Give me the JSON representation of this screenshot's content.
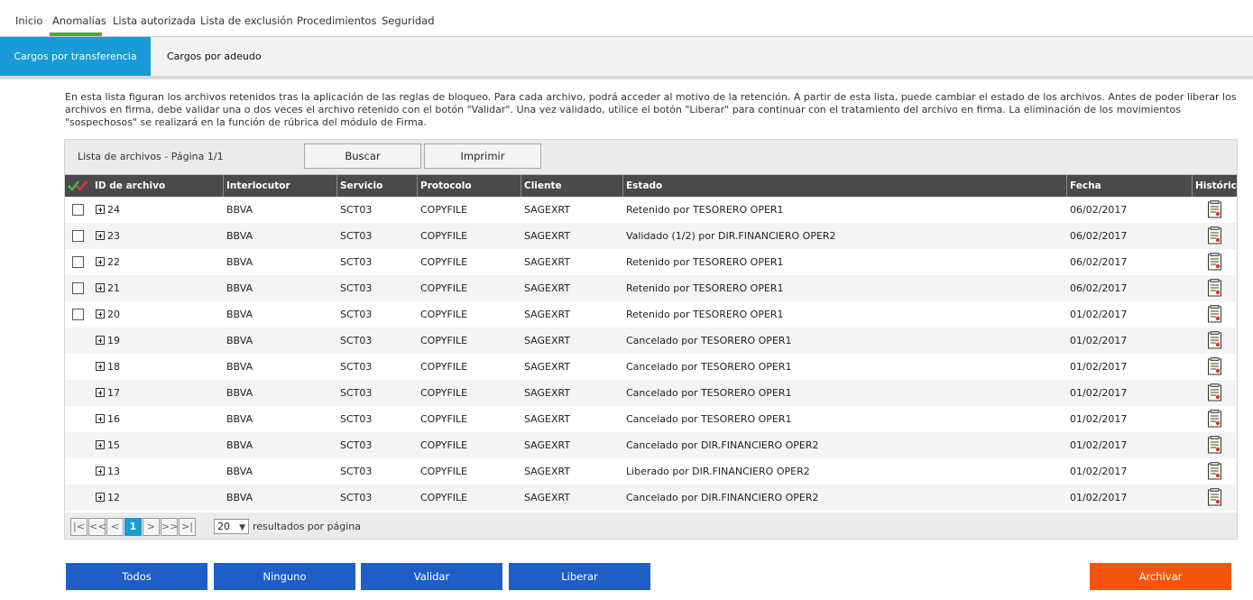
{
  "nav": {
    "items": [
      "Inicio",
      "Anomalías",
      "Lista autorizada",
      "Lista de exclusión",
      "Procedimientos",
      "Seguridad"
    ],
    "active": "Anomalías"
  },
  "subtabs": {
    "active": "Cargos por transferencia",
    "other": "Cargos por adeudo"
  },
  "description": "En esta lista figuran los archivos retenidos tras la aplicación de las reglas de bloqueo. Para cada archivo, podrá acceder al motivo de la retención. A partir de esta lista, puede cambiar el estado de los archivos. Antes de poder liberar los archivos en firma, debe validar una o dos veces el archivo retenido con el botón \"Validar\". Una vez validado, utilice el botón \"Liberar\" para continuar con el tratamiento del archivo en firma. La eliminación de los movimientos \"sospechosos\" se realizará en la función de rúbrica del módulo de Firma.",
  "panel": {
    "title": "Lista de archivos - Página 1/1",
    "search_label": "Buscar",
    "print_label": "Imprimir"
  },
  "table": {
    "headers": {
      "id": "ID de archivo",
      "interlocutor": "Interlocutor",
      "servicio": "Servicio",
      "protocolo": "Protocolo",
      "cliente": "Cliente",
      "estado": "Estado",
      "fecha": "Fecha",
      "historico": "Histórico"
    },
    "rows": [
      {
        "id": "24",
        "interlocutor": "BBVA",
        "servicio": "SCT03",
        "protocolo": "COPYFILE",
        "cliente": "SAGEXRT",
        "estado": "Retenido por TESORERO OPER1",
        "fecha": "06/02/2017",
        "checkbox": true
      },
      {
        "id": "23",
        "interlocutor": "BBVA",
        "servicio": "SCT03",
        "protocolo": "COPYFILE",
        "cliente": "SAGEXRT",
        "estado": "Validado (1/2) por DIR.FINANCIERO OPER2",
        "fecha": "06/02/2017",
        "checkbox": true
      },
      {
        "id": "22",
        "interlocutor": "BBVA",
        "servicio": "SCT03",
        "protocolo": "COPYFILE",
        "cliente": "SAGEXRT",
        "estado": "Retenido por TESORERO OPER1",
        "fecha": "06/02/2017",
        "checkbox": true
      },
      {
        "id": "21",
        "interlocutor": "BBVA",
        "servicio": "SCT03",
        "protocolo": "COPYFILE",
        "cliente": "SAGEXRT",
        "estado": "Retenido por TESORERO OPER1",
        "fecha": "06/02/2017",
        "checkbox": true
      },
      {
        "id": "20",
        "interlocutor": "BBVA",
        "servicio": "SCT03",
        "protocolo": "COPYFILE",
        "cliente": "SAGEXRT",
        "estado": "Retenido por TESORERO OPER1",
        "fecha": "01/02/2017",
        "checkbox": true
      },
      {
        "id": "19",
        "interlocutor": "BBVA",
        "servicio": "SCT03",
        "protocolo": "COPYFILE",
        "cliente": "SAGEXRT",
        "estado": "Cancelado por TESORERO OPER1",
        "fecha": "01/02/2017",
        "checkbox": false
      },
      {
        "id": "18",
        "interlocutor": "BBVA",
        "servicio": "SCT03",
        "protocolo": "COPYFILE",
        "cliente": "SAGEXRT",
        "estado": "Cancelado por TESORERO OPER1",
        "fecha": "01/02/2017",
        "checkbox": false
      },
      {
        "id": "17",
        "interlocutor": "BBVA",
        "servicio": "SCT03",
        "protocolo": "COPYFILE",
        "cliente": "SAGEXRT",
        "estado": "Cancelado por TESORERO OPER1",
        "fecha": "01/02/2017",
        "checkbox": false
      },
      {
        "id": "16",
        "interlocutor": "BBVA",
        "servicio": "SCT03",
        "protocolo": "COPYFILE",
        "cliente": "SAGEXRT",
        "estado": "Cancelado por TESORERO OPER1",
        "fecha": "01/02/2017",
        "checkbox": false
      },
      {
        "id": "15",
        "interlocutor": "BBVA",
        "servicio": "SCT03",
        "protocolo": "COPYFILE",
        "cliente": "SAGEXRT",
        "estado": "Cancelado por DIR.FINANCIERO OPER2",
        "fecha": "01/02/2017",
        "checkbox": false
      },
      {
        "id": "13",
        "interlocutor": "BBVA",
        "servicio": "SCT03",
        "protocolo": "COPYFILE",
        "cliente": "SAGEXRT",
        "estado": "Liberado por DIR.FINANCIERO OPER2",
        "fecha": "01/02/2017",
        "checkbox": false
      },
      {
        "id": "12",
        "interlocutor": "BBVA",
        "servicio": "SCT03",
        "protocolo": "COPYFILE",
        "cliente": "SAGEXRT",
        "estado": "Cancelado por DIR.FINANCIERO OPER2",
        "fecha": "01/02/2017",
        "checkbox": false
      }
    ]
  },
  "pager": {
    "first": "|<",
    "prev_page": "<<",
    "prev": "<",
    "current": "1",
    "next": ">",
    "next_page": ">>",
    "last": ">|",
    "per_page_value": "20",
    "per_page_label": "resultados por página"
  },
  "actions": {
    "todos": "Todos",
    "ninguno": "Ninguno",
    "validar": "Validar",
    "liberar": "Liberar",
    "archivar": "Archivar"
  },
  "icons": {
    "select_all": "double-check-icon",
    "expand": "plus-box-icon",
    "history": "history-document-icon"
  },
  "colors": {
    "accent_blue": "#1a9ad6",
    "button_blue": "#1f5ec7",
    "button_orange": "#f2560e",
    "nav_active": "#3db13d",
    "header_dark": "#4a4a4a"
  }
}
